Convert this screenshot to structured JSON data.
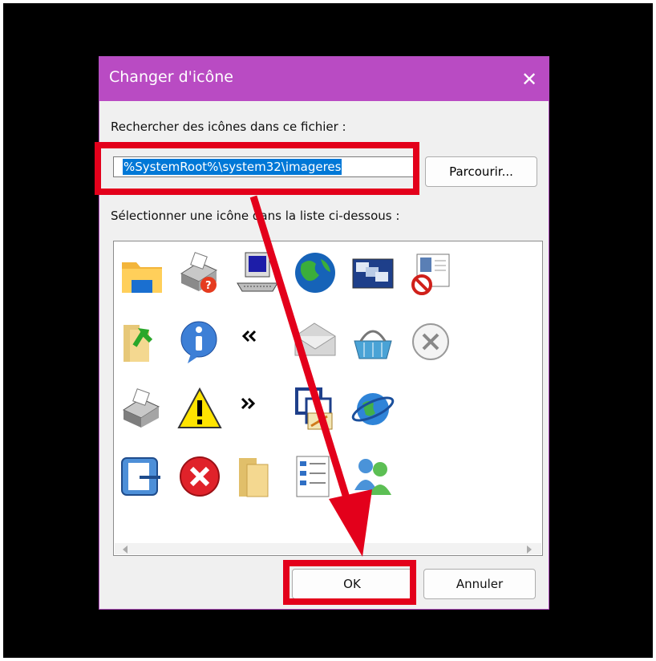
{
  "dialog": {
    "title": "Changer d'icône",
    "close_glyph": "✕",
    "search_label": "Rechercher des icônes dans ce fichier :",
    "file_path": "%SystemRoot%\\system32\\imageres",
    "browse_label": "Parcourir...",
    "select_label": "Sélectionner une icône dans la liste ci-dessous :",
    "ok_label": "OK",
    "cancel_label": "Annuler"
  },
  "icons": [
    "folder-icon",
    "printer-help-icon",
    "computer-terminal-icon",
    "globe-icon",
    "windows-icon",
    "document-forbidden-icon",
    "folder-share-icon",
    "info-icon",
    "double-chevron-left-icon",
    "envelope-icon",
    "shopping-basket-icon",
    "circle-x-icon",
    "printer-icon",
    "warning-icon",
    "double-chevron-right-icon",
    "layout-grid-icon",
    "globe-link-icon",
    "exit-door-icon",
    "error-icon",
    "folder-open-icon",
    "document-list-icon",
    "users-icon"
  ],
  "colors": {
    "titlebar": "#b94bc3",
    "highlight": "#e3001b",
    "selection": "#0078d7"
  }
}
